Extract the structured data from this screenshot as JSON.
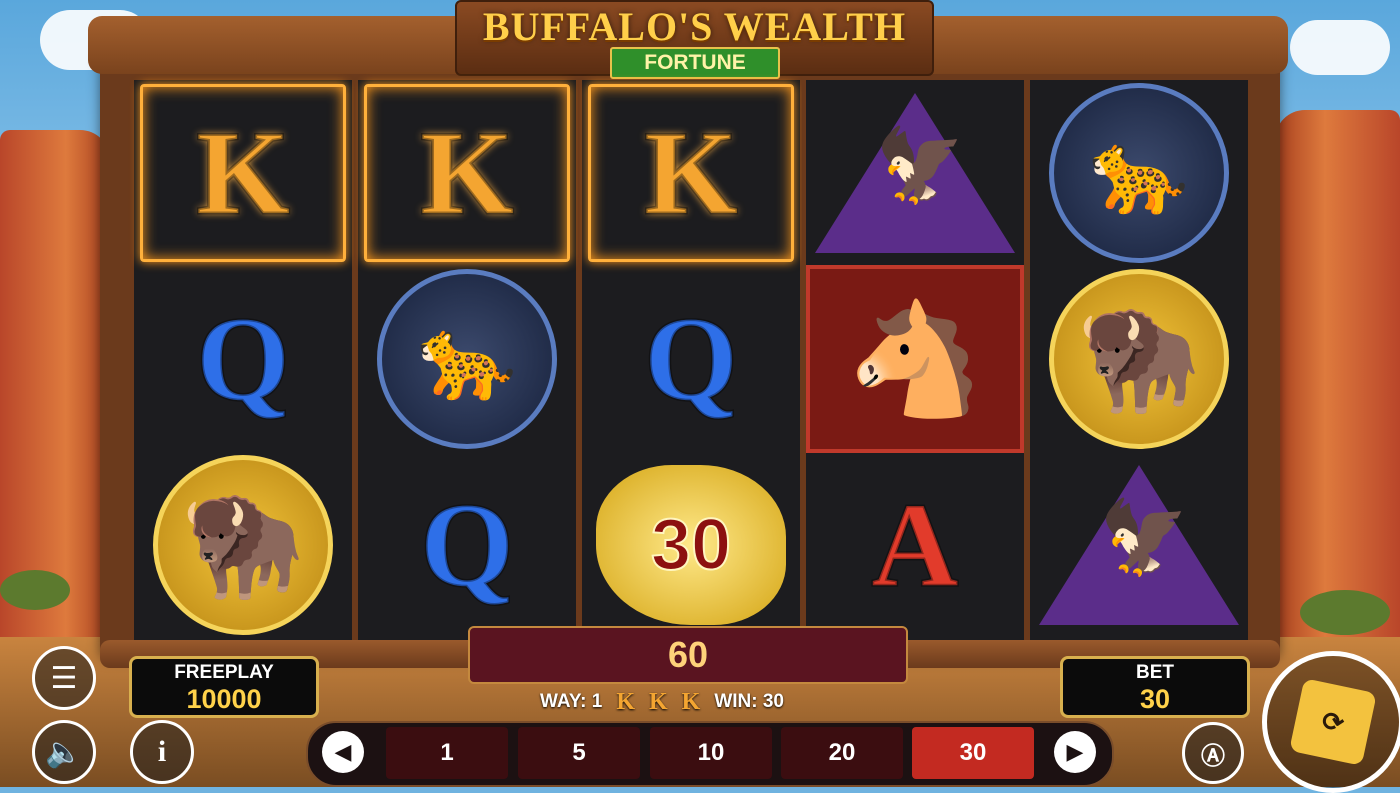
{
  "game": {
    "title": "BUFFALO'S WEALTH",
    "subtitle": "FORTUNE"
  },
  "reels": [
    [
      "K",
      "Q",
      "buffalo"
    ],
    [
      "K",
      "panther",
      "Q"
    ],
    [
      "K",
      "Q",
      "30"
    ],
    [
      "eagle",
      "horse",
      "A"
    ],
    [
      "panther",
      "buffalo",
      "eagle"
    ]
  ],
  "symbols": {
    "r0": {
      "s0": "K",
      "s1": "Q"
    },
    "r1": {
      "s0": "K",
      "s2": "Q"
    },
    "r2": {
      "s0": "K",
      "s1": "Q",
      "coin": "30"
    },
    "r3": {
      "s2": "A"
    }
  },
  "win": {
    "total": "60",
    "way_label": "WAY: 1",
    "way_symbols": [
      "K",
      "K",
      "K"
    ],
    "win_label": "WIN: 30"
  },
  "freeplay": {
    "label": "FREEPLAY",
    "value": "10000"
  },
  "bet": {
    "label": "BET",
    "value": "30"
  },
  "bet_options": [
    "1",
    "5",
    "10",
    "20",
    "30"
  ],
  "selected_bet": "30",
  "icons": {
    "menu": "hamburger-menu-icon",
    "sound": "speaker-icon",
    "info": "info-icon",
    "autoplay": "autoplay-icon",
    "spin": "spin-icon"
  },
  "colors": {
    "win_highlight": "#ffb03b",
    "selected_bet": "#c32a21",
    "gold_text": "#ffd24a"
  }
}
